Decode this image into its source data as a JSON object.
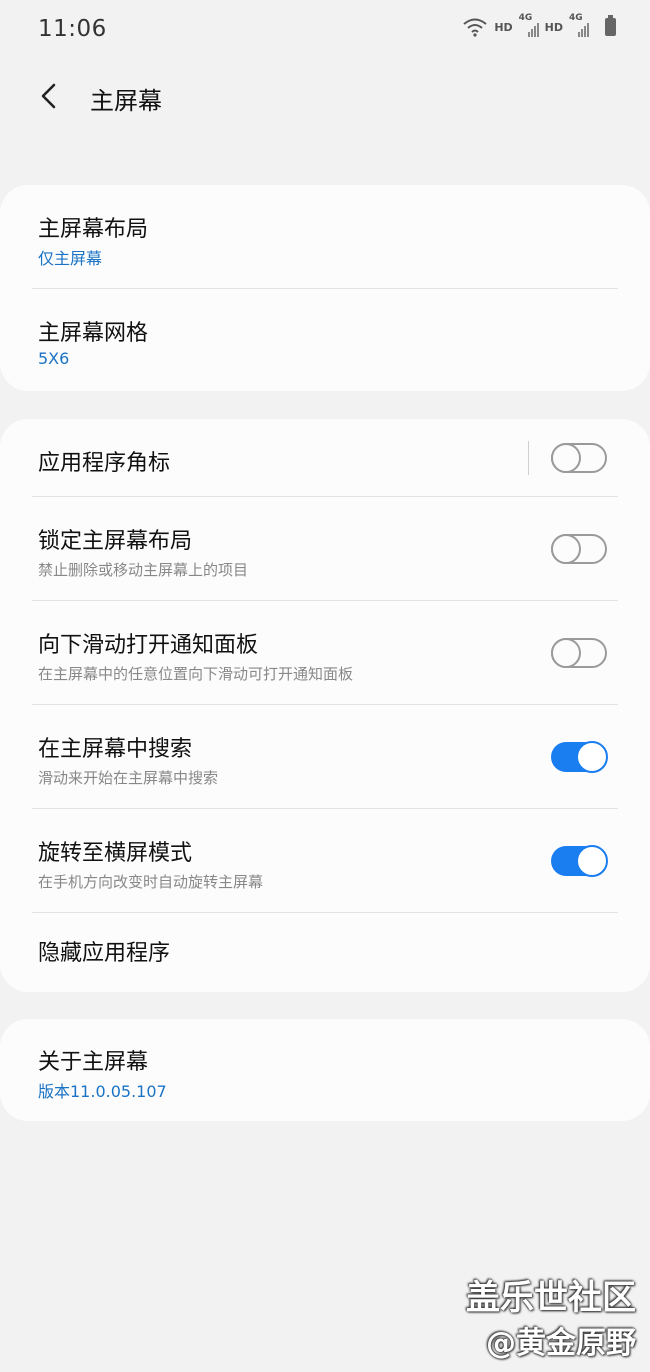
{
  "status_bar": {
    "time": "11:06",
    "hd_label": "HD",
    "net_label": "4G"
  },
  "header": {
    "title": "主屏幕"
  },
  "card1": [
    {
      "title": "主屏幕布局",
      "value": "仅主屏幕"
    },
    {
      "title": "主屏幕网格",
      "value": "5X6"
    }
  ],
  "card2": [
    {
      "title": "应用程序角标",
      "toggle": "off"
    },
    {
      "title": "锁定主屏幕布局",
      "subtitle": "禁止删除或移动主屏幕上的项目",
      "toggle": "off"
    },
    {
      "title": "向下滑动打开通知面板",
      "subtitle": "在主屏幕中的任意位置向下滑动可打开通知面板",
      "toggle": "off"
    },
    {
      "title": "在主屏幕中搜索",
      "subtitle": "滑动来开始在主屏幕中搜索",
      "toggle": "on"
    },
    {
      "title": "旋转至横屏模式",
      "subtitle": "在手机方向改变时自动旋转主屏幕",
      "toggle": "on"
    },
    {
      "title": "隐藏应用程序"
    }
  ],
  "card3": [
    {
      "title": "关于主屏幕",
      "value": "版本11.0.05.107"
    }
  ],
  "watermark": {
    "line1": "盖乐世社区",
    "line2": "@黄金原野"
  },
  "colors": {
    "accent": "#1a7ef0",
    "link": "#1a73c5",
    "background": "#f2f2f2",
    "card": "#fcfcfc"
  }
}
